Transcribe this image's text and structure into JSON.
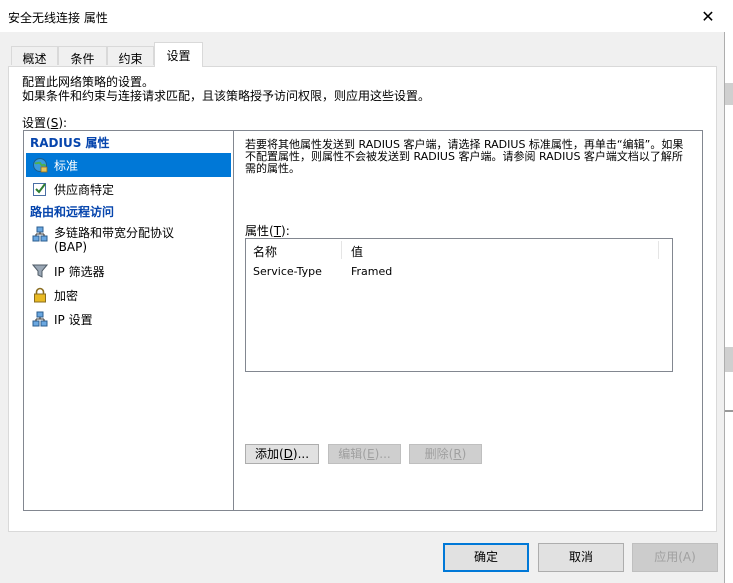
{
  "window": {
    "title": "安全无线连接 属性",
    "close_glyph": "✕"
  },
  "tabs": [
    {
      "label": "概述"
    },
    {
      "label": "条件"
    },
    {
      "label": "约束"
    },
    {
      "label": "设置"
    }
  ],
  "settings_page": {
    "description_line1": "配置此网络策略的设置。",
    "description_line2": "如果条件和约束与连接请求匹配，且该策略授予访问权限，则应用这些设置。",
    "settings_label_prefix": "设置(",
    "settings_label_key": "S",
    "settings_label_suffix": "):"
  },
  "left_nav": {
    "category_radius": "RADIUS 属性",
    "category_routing": "路由和远程访问",
    "items": [
      {
        "label": "标准",
        "icon": "globe-network-icon",
        "selected": true
      },
      {
        "label": "供应商特定",
        "icon": "checkbox-icon",
        "selected": false
      },
      {
        "label": "多链路和带宽分配协议",
        "label2": "(BAP)",
        "icon": "network-icon",
        "selected": false
      },
      {
        "label": "IP 筛选器",
        "icon": "funnel-icon",
        "selected": false
      },
      {
        "label": "加密",
        "icon": "lock-icon",
        "selected": false
      },
      {
        "label": "IP 设置",
        "icon": "network-icon",
        "selected": false
      }
    ]
  },
  "right_panel": {
    "description": "若要将其他属性发送到 RADIUS 客户端，请选择 RADIUS 标准属性，再单击“编辑”。如果不配置属性，则属性不会被发送到 RADIUS 客户端。请参阅 RADIUS 客户端文档以了解所需的属性。",
    "attributes_label_prefix": "属性(",
    "attributes_label_key": "T",
    "attributes_label_suffix": "):",
    "columns": {
      "name": "名称",
      "value": "值"
    },
    "rows": [
      {
        "name": "Service-Type",
        "value": "Framed"
      }
    ],
    "buttons": {
      "add_prefix": "添加(",
      "add_key": "D",
      "add_suffix": ")...",
      "edit_prefix": "编辑(",
      "edit_key": "E",
      "edit_suffix": ")...",
      "delete_prefix": "删除(",
      "delete_key": "R",
      "delete_suffix": ")"
    }
  },
  "footer": {
    "ok": "确定",
    "cancel": "取消",
    "apply": "应用(A)"
  },
  "colors": {
    "selection": "#0078d7",
    "category": "#0645ad"
  }
}
